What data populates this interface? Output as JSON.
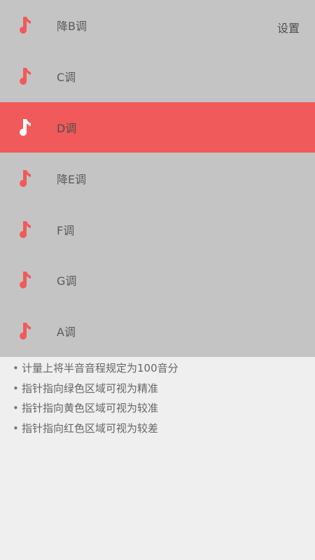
{
  "header": {
    "settings_label": "设置"
  },
  "menu": {
    "items": [
      {
        "label": "降B调",
        "active": false
      },
      {
        "label": "C调",
        "active": false
      },
      {
        "label": "D调",
        "active": true
      },
      {
        "label": "降E调",
        "active": false
      },
      {
        "label": "F调",
        "active": false
      },
      {
        "label": "G调",
        "active": false
      },
      {
        "label": "A调",
        "active": false
      }
    ]
  },
  "notes": [
    "计量上将半音音程规定为100音分",
    "指针指向绿色区域可视为精准",
    "指针指向黄色区域可视为较准",
    "指针指向红色区域可视为较差"
  ],
  "icons": {
    "note": "music-note-icon"
  },
  "colors": {
    "accent": "#f15a5a",
    "menu_background": "#c4c4c4",
    "page_background": "#efefef",
    "active_icon": "#ffffff"
  }
}
